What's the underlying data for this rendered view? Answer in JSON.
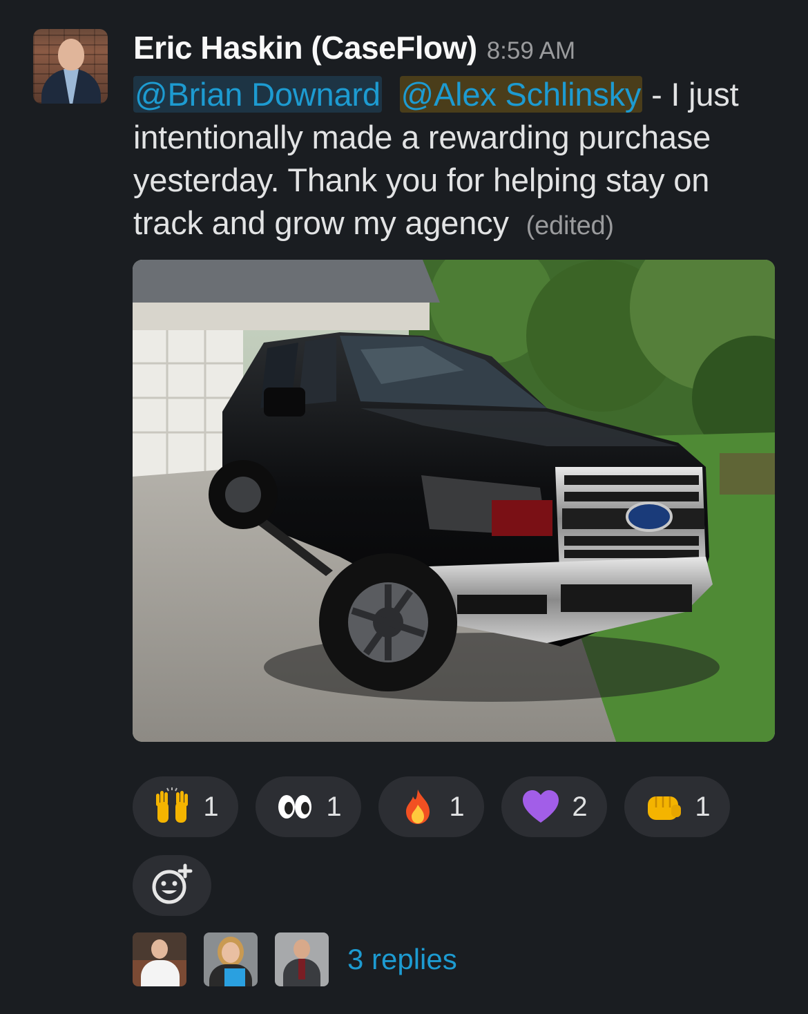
{
  "message": {
    "author": "Eric Haskin (CaseFlow)",
    "timestamp": "8:59 AM",
    "mentions": [
      "@Brian Downard",
      "@Alex Schlinsky"
    ],
    "text_line1_tail": " - I just",
    "text_rest": "intentionally made a rewarding purchase yesterday.  Thank you for helping stay on track and grow my agency",
    "edited_label": "(edited)"
  },
  "attachment": {
    "icon": "photo-of-black-pickup-truck",
    "truck_color": "#0e0f10"
  },
  "reactions": [
    {
      "icon": "raised-hands-icon",
      "count": "1"
    },
    {
      "icon": "eyes-icon",
      "count": "1"
    },
    {
      "icon": "fire-icon",
      "count": "1"
    },
    {
      "icon": "purple-heart-icon",
      "count": "2"
    },
    {
      "icon": "fist-bump-icon",
      "count": "1"
    }
  ],
  "add_reaction": {
    "icon": "add-emoji-icon"
  },
  "thread": {
    "reply_avatars": [
      "avatar-man-white-shirt",
      "avatar-woman-glasses",
      "avatar-man-suit"
    ],
    "replies_label": "3 replies"
  },
  "colors": {
    "background": "#1a1d21",
    "link": "#1d9bd1",
    "mention_bg": "#1d3444",
    "mention_alt_bg": "#4a3d1a",
    "pill": "#2c2e33"
  }
}
